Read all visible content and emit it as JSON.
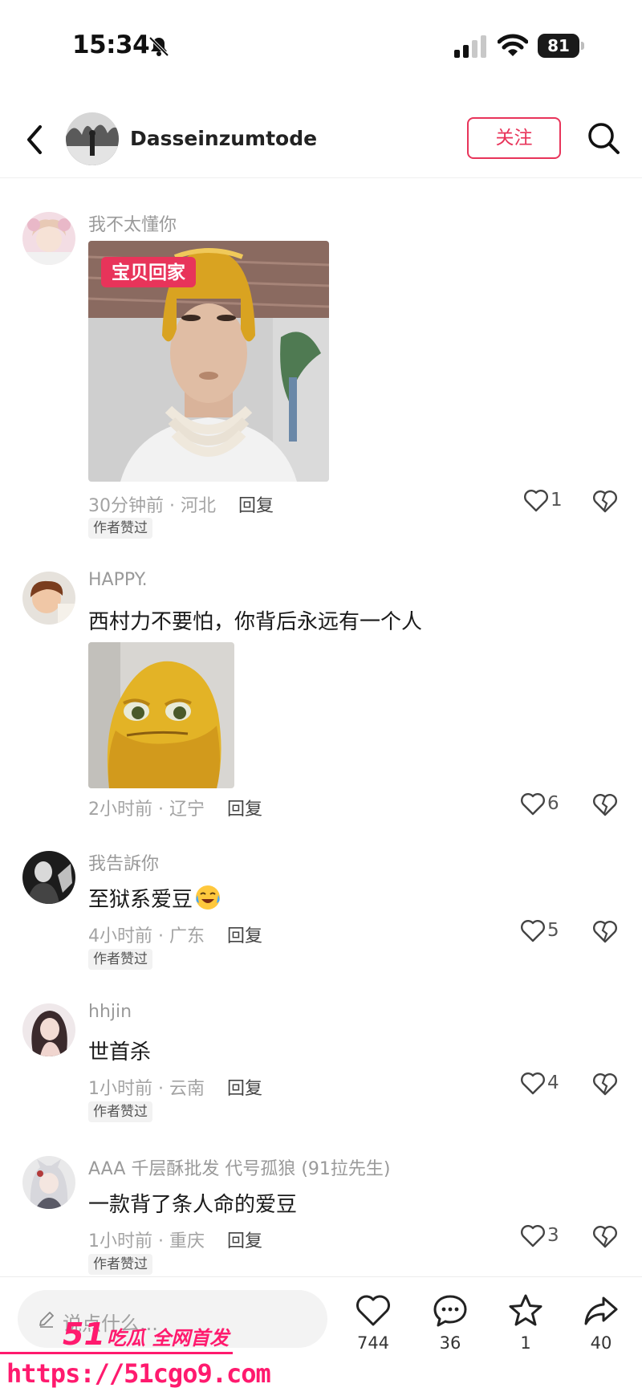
{
  "status_bar": {
    "time": "15:34",
    "battery": "81"
  },
  "header": {
    "name": "Dasseinzumtode",
    "follow_label": "关注"
  },
  "comments": [
    {
      "user": "我不太懂你",
      "text": "",
      "image_tag": "宝贝回家",
      "time": "30分钟前 · 河北",
      "reply": "回复",
      "likes": "1",
      "author_liked": "作者赞过"
    },
    {
      "user": "HAPPY.",
      "text": "西村力不要怕，你背后永远有一个人",
      "time": "2小时前 · 辽宁",
      "reply": "回复",
      "likes": "6"
    },
    {
      "user": "我告訴你",
      "text": "至狱系爱豆",
      "time": "4小时前 · 广东",
      "reply": "回复",
      "likes": "5",
      "author_liked": "作者赞过"
    },
    {
      "user": "hhjin",
      "text": "世首杀",
      "time": "1小时前 · 云南",
      "reply": "回复",
      "likes": "4",
      "author_liked": "作者赞过"
    },
    {
      "user": "AAA 千层酥批发 代号孤狼 (91拉先生)",
      "text": "一款背了条人命的爱豆",
      "time": "1小时前 · 重庆",
      "reply": "回复",
      "likes": "3",
      "author_liked": "作者赞过"
    }
  ],
  "bottom_bar": {
    "placeholder": "说点什么...",
    "likes": "744",
    "comments": "36",
    "favorites": "1",
    "shares": "40"
  },
  "watermark": {
    "logo_num": "51",
    "logo_text": "吃瓜 全网首发",
    "url": "https://51cgo9.com"
  }
}
